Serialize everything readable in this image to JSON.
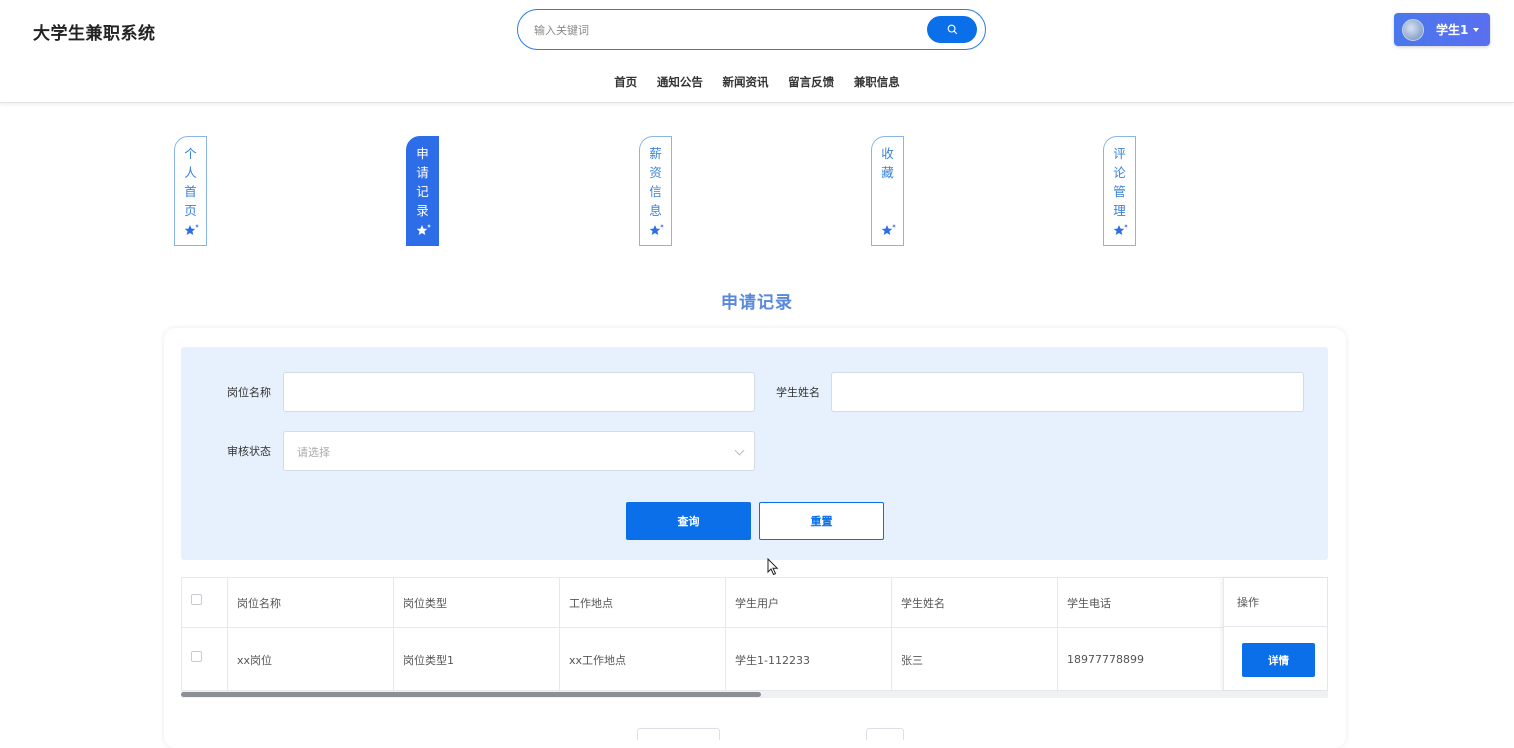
{
  "app": {
    "title": "大学生兼职系统"
  },
  "search": {
    "placeholder": "输入关键词",
    "value": ""
  },
  "user": {
    "label": "学生1"
  },
  "nav": [
    "首页",
    "通知公告",
    "新闻资讯",
    "留言反馈",
    "兼职信息"
  ],
  "tabs": [
    {
      "label": "个人首页",
      "active": false
    },
    {
      "label": "申请记录",
      "active": true
    },
    {
      "label": "薪资信息",
      "active": false
    },
    {
      "label": "收藏",
      "active": false
    },
    {
      "label": "评论管理",
      "active": false
    }
  ],
  "page_title": "申请记录",
  "filter": {
    "job_name_label": "岗位名称",
    "job_name_value": "",
    "student_name_label": "学生姓名",
    "student_name_value": "",
    "status_label": "审核状态",
    "status_placeholder": "请选择",
    "query_label": "查询",
    "reset_label": "重置"
  },
  "table": {
    "columns": [
      "岗位名称",
      "岗位类型",
      "工作地点",
      "学生用户",
      "学生姓名",
      "学生电话"
    ],
    "action_header": "操作",
    "rows": [
      {
        "cells": [
          "xx岗位",
          "岗位类型1",
          "xx工作地点",
          "学生1-112233",
          "张三",
          "18977778899"
        ],
        "action": "详情"
      }
    ]
  },
  "colors": {
    "accent": "#0a6fe8",
    "active_tab": "#2d6ee8",
    "title": "#5a88db",
    "filter_bg": "#e6f1fd"
  }
}
